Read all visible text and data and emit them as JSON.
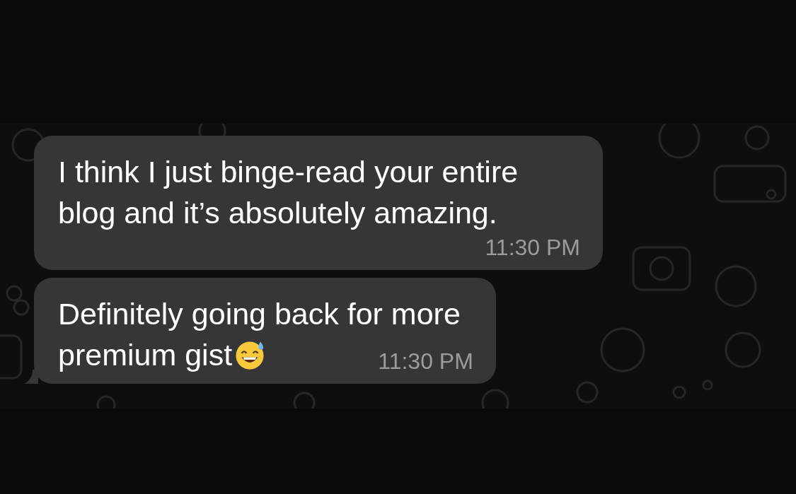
{
  "messages": [
    {
      "lines": [
        "I think I just binge-read your entire",
        "blog and it’s absolutely amazing."
      ],
      "time": "11:30 PM",
      "tail": false,
      "trailing_emoji": false
    },
    {
      "lines": [
        "Definitely going back for more",
        "premium gist"
      ],
      "time": "11:30 PM",
      "tail": true,
      "trailing_emoji": true
    }
  ]
}
